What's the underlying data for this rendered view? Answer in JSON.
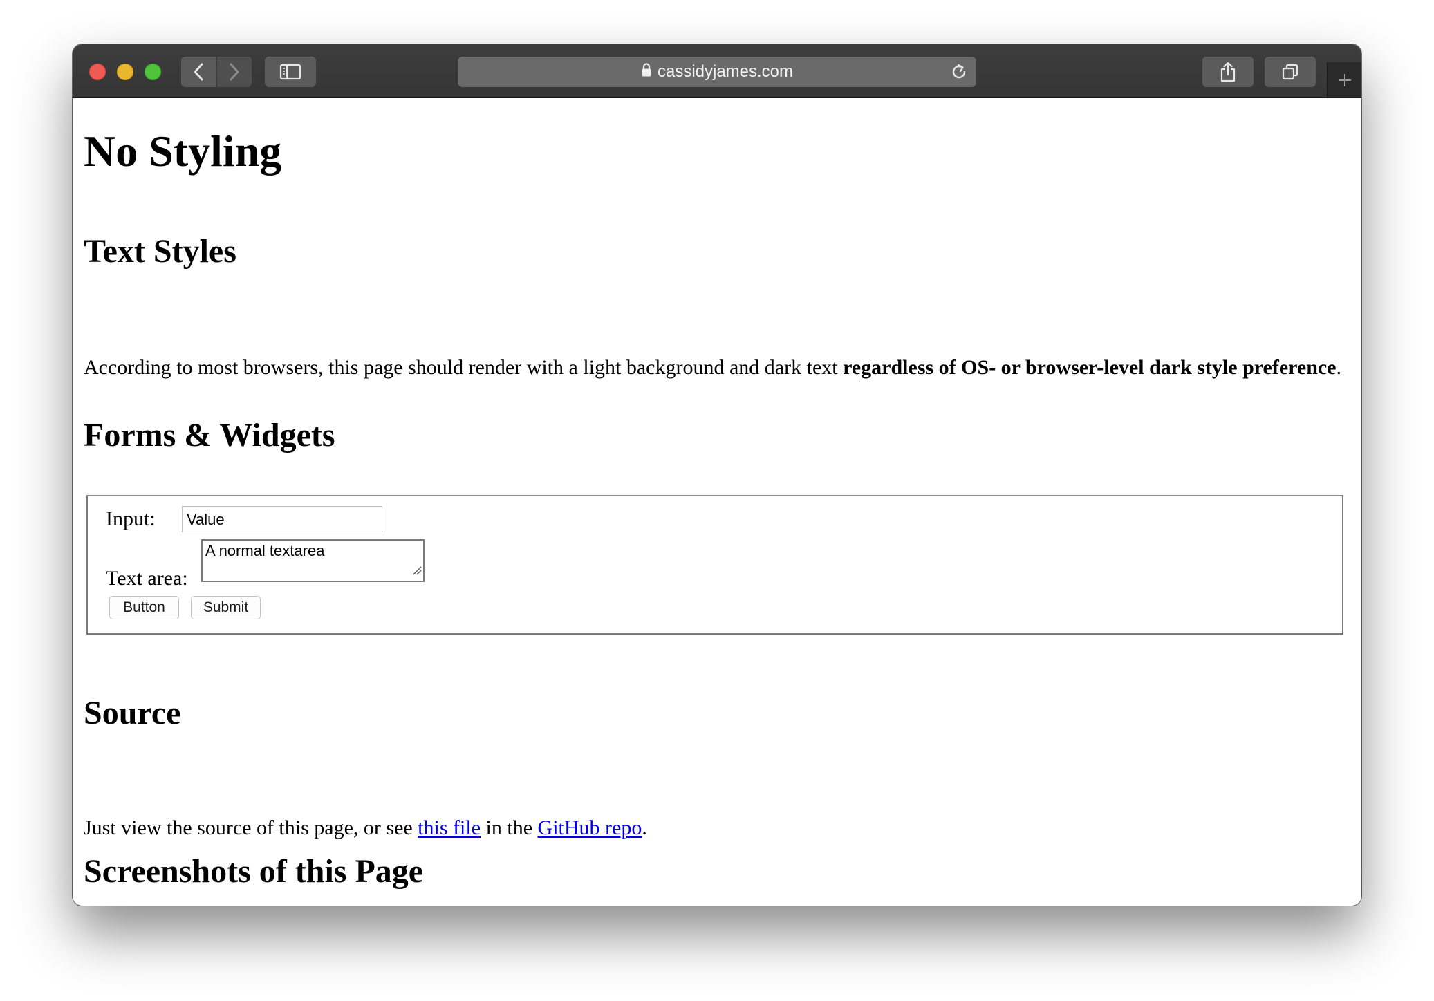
{
  "browser": {
    "url_display": "cassidyjames.com",
    "icons": {
      "back": "chevron-left-icon",
      "forward": "chevron-right-icon",
      "sidebar": "sidebar-icon",
      "lock": "lock-icon",
      "reload": "reload-icon",
      "share": "share-icon",
      "tabs": "tab-overview-icon",
      "new_tab": "plus-icon"
    },
    "colors": {
      "toolbar": "#383838",
      "close": "#ee5b55",
      "minimize": "#e9b62f",
      "maximize": "#4ec33b"
    }
  },
  "page": {
    "title": "No Styling",
    "text_styles": {
      "heading": "Text Styles",
      "paragraph_plain": "According to most browsers, this page should render with a light background and dark text ",
      "paragraph_bold": "regardless of OS- or browser-level dark style preference",
      "paragraph_end": "."
    },
    "forms": {
      "heading": "Forms & Widgets",
      "input_label": "Input:",
      "input_value": "Value",
      "textarea_label": "Text area:",
      "textarea_value": "A normal textarea",
      "button_label": "Button",
      "submit_label": "Submit"
    },
    "source": {
      "heading": "Source",
      "text_1": "Just view the source of this page, or see ",
      "link_1": "this file",
      "text_2": " in the ",
      "link_2": "GitHub repo",
      "text_3": "."
    },
    "screenshots": {
      "heading": "Screenshots of this Page"
    },
    "link_color": "#0000ee"
  }
}
